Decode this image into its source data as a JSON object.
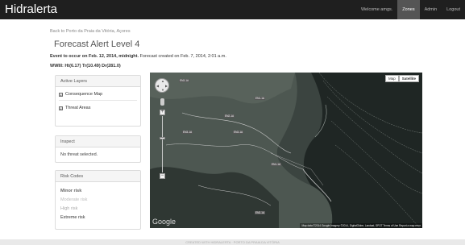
{
  "app": {
    "brand": "Hidralerta"
  },
  "nav": {
    "items": [
      "Welcome amgs.",
      "Zones",
      "Admin",
      "Logout"
    ]
  },
  "back_link": "Back to Porto da Praia da Vitória, Açores",
  "title": "Forecast Alert Level 4",
  "event": {
    "prefix": "Event to occur on Feb. 12, 2014, midnight.",
    "created": "Forecast created on Feb. 7, 2014, 2:01 a.m."
  },
  "wwiii": "WWIII: Ht(6.17) Tr(10.49) Dr(281.0)",
  "layers": {
    "heading": "Active Layers",
    "items": [
      {
        "label": "Consequence Map",
        "checked": "☑"
      },
      {
        "label": "Threat Areas",
        "checked": "☑"
      }
    ]
  },
  "inspect": {
    "heading": "Inspect",
    "text": "No threat selected."
  },
  "risk": {
    "heading": "Risk Codes",
    "items": [
      "Minor risk",
      "Moderate risk",
      "High risk",
      "Extreme risk"
    ]
  },
  "map": {
    "type_buttons": [
      "Map",
      "Satellite"
    ],
    "google": "Google",
    "attribution": "Map data ©2014 Google Imagery ©2014, DigitalGlobe, Landsat, SPOT   Terms of Use   Report a map error",
    "zoom_plus": "+",
    "zoom_minus": "−",
    "road_labels": [
      "EN3-1A",
      "EN1-1A",
      "EN2-1A",
      "EN3-1A",
      "EN3-1A",
      "EN1-1A",
      "EN2-1A"
    ]
  },
  "footer": "CREATED WITH HIDRALERTA · PORTO DA PRAIA DA VITÓRIA"
}
